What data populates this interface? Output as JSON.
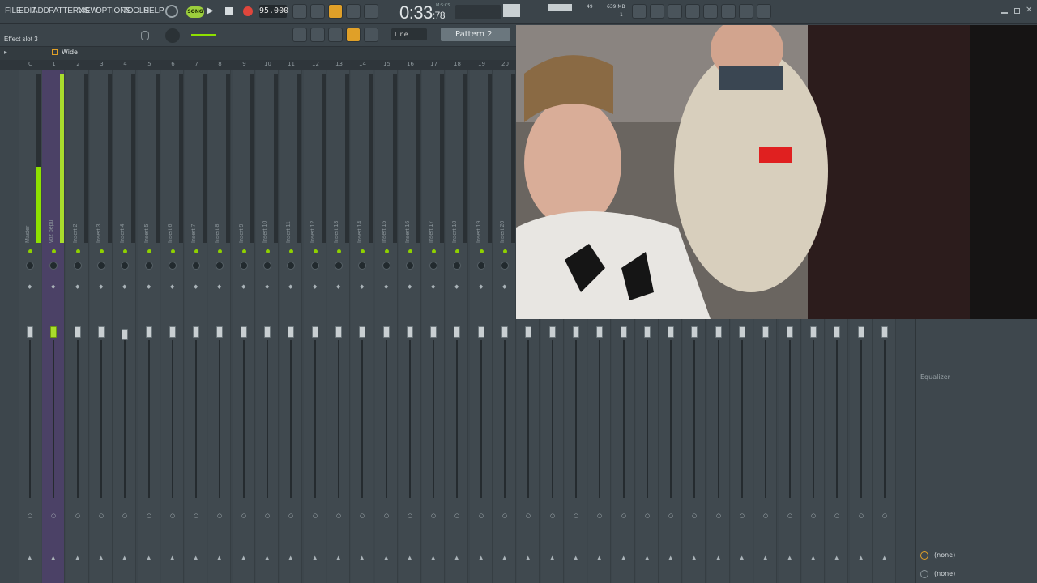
{
  "menu": {
    "file": "FILE",
    "edit": "EDIT",
    "add": "ADD",
    "patterns": "PATTERNS",
    "view": "VIEW",
    "options": "OPTIONS",
    "tools": "TOOLS",
    "help": "HELP"
  },
  "transport": {
    "song_label": "SONG",
    "tempo": "95.000",
    "time_main": "0:33",
    "time_sub": ":78",
    "time_unit": "M:S:CS",
    "cpu_num": "49",
    "ram": "639 MB",
    "voices": "1"
  },
  "toolbar": {
    "snap_value": "Line",
    "pattern_name": "Pattern 2"
  },
  "hint": {
    "text": "Effect slot 3"
  },
  "mixer": {
    "view_mode": "Wide",
    "tracks": [
      {
        "label": "Master",
        "num": "C"
      },
      {
        "label": "voz pepu",
        "num": "1"
      },
      {
        "label": "Insert 2",
        "num": "2"
      },
      {
        "label": "Insert 3",
        "num": "3"
      },
      {
        "label": "Insert 4",
        "num": "4"
      },
      {
        "label": "Insert 5",
        "num": "5"
      },
      {
        "label": "Insert 6",
        "num": "6"
      },
      {
        "label": "Insert 7",
        "num": "7"
      },
      {
        "label": "Insert 8",
        "num": "8"
      },
      {
        "label": "Insert 9",
        "num": "9"
      },
      {
        "label": "Insert 10",
        "num": "10"
      },
      {
        "label": "Insert 11",
        "num": "11"
      },
      {
        "label": "Insert 12",
        "num": "12"
      },
      {
        "label": "Insert 13",
        "num": "13"
      },
      {
        "label": "Insert 14",
        "num": "14"
      },
      {
        "label": "Insert 15",
        "num": "15"
      },
      {
        "label": "Insert 16",
        "num": "16"
      },
      {
        "label": "Insert 17",
        "num": "17"
      },
      {
        "label": "Insert 18",
        "num": "18"
      },
      {
        "label": "Insert 19",
        "num": "19"
      },
      {
        "label": "Insert 20",
        "num": "20"
      }
    ]
  },
  "right_panel": {
    "plugin": "Equalizer",
    "slot1": "(none)",
    "slot2": "(none)"
  },
  "colors": {
    "accent_green": "#8ee000",
    "selected_track": "#4b4166",
    "record": "#e0463c"
  }
}
